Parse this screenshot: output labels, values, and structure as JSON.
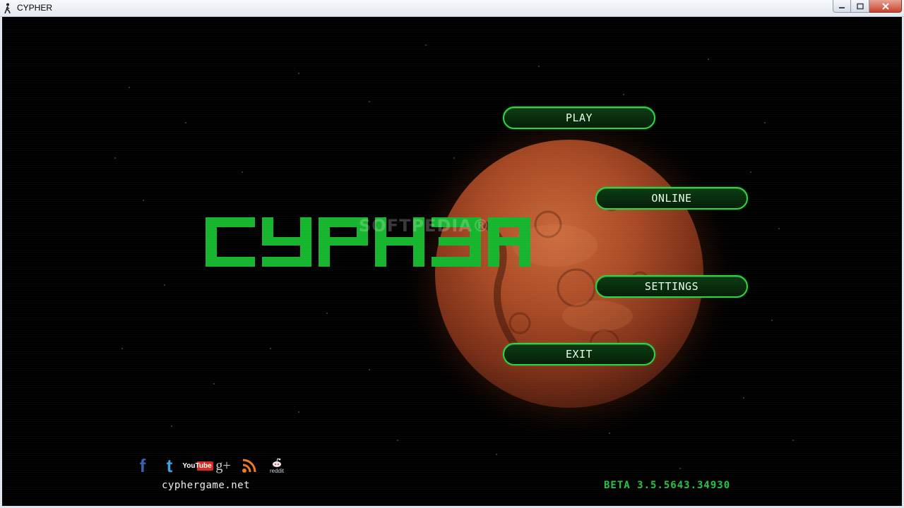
{
  "window": {
    "title": "CYPHER",
    "app_icon": "runner-icon",
    "controls": [
      "minimize-icon",
      "maximize-icon",
      "close-icon"
    ]
  },
  "game": {
    "logo_text": "CYPHER",
    "watermark": "SOFTPEDIA®",
    "menu": {
      "play": "PLAY",
      "online": "ONLINE",
      "settings": "SETTINGS",
      "exit": "EXIT"
    },
    "social": {
      "facebook": "f",
      "twitter": "t",
      "youtube": "YouTube",
      "googleplus": "g+",
      "rss": "rss-icon",
      "reddit": "reddit"
    },
    "site": "cyphergame.net",
    "version": "BETA 3.5.5643.34930"
  },
  "colors": {
    "accent_green": "#22c545",
    "button_border": "#2fd346",
    "planet": "#a84a25"
  }
}
